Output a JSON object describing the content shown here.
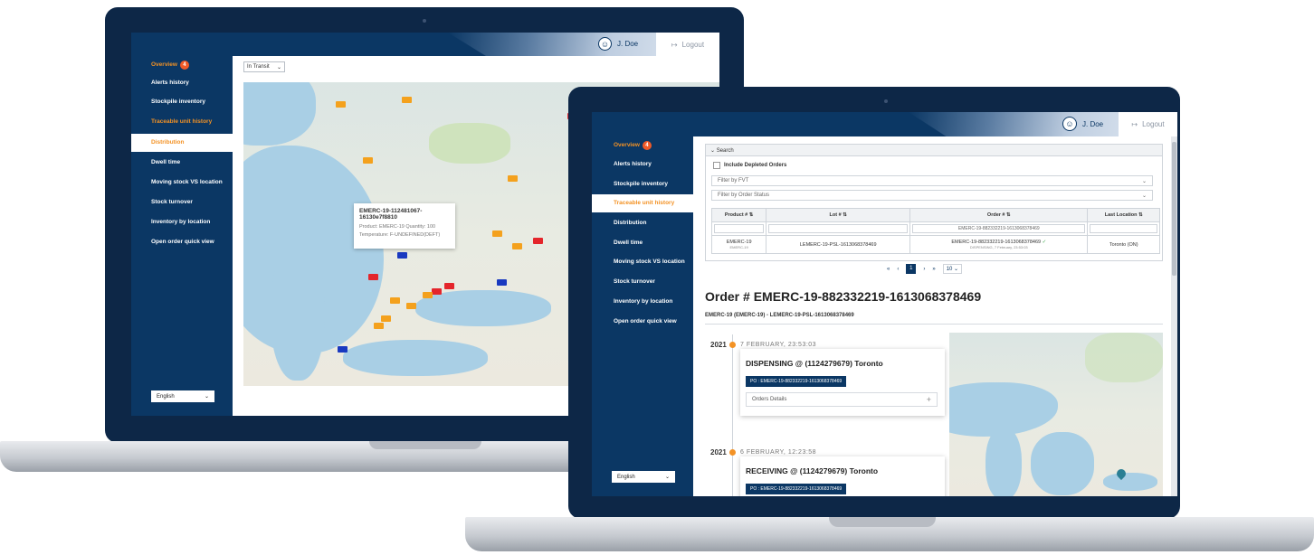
{
  "app": {
    "user_name": "J. Doe",
    "logout_label": "Logout",
    "language": "English",
    "nav": [
      {
        "label": "Overview",
        "badge": "4"
      },
      {
        "label": "Alerts history"
      },
      {
        "label": "Stockpile inventory"
      },
      {
        "label": "Traceable unit history"
      },
      {
        "label": "Distribution"
      },
      {
        "label": "Dwell time"
      },
      {
        "label": "Moving stock VS location"
      },
      {
        "label": "Stock turnover"
      },
      {
        "label": "Inventory by location"
      },
      {
        "label": "Open order quick view"
      }
    ]
  },
  "left_screen": {
    "active_nav": "Distribution",
    "status_filter": "In Transit",
    "popup": {
      "title_line1": "EMERC-19-112481067-",
      "title_line2": "16130e7f8810",
      "line2": "Product: EMERC-19    Quantity: 100",
      "line3": "Temperature: F-UNDEFINED(DEFT)"
    }
  },
  "right_screen": {
    "active_nav": "Traceable unit history",
    "search_label": "Search",
    "include_depleted": "Include Depleted Orders",
    "filter_fvt": "Filter by FVT",
    "filter_status": "Filter by Order Status",
    "table": {
      "headers": [
        "Product #",
        "Lot #",
        "Order #",
        "Last Location"
      ],
      "search_order_value": "EMERC-19-882332219-1613068378469",
      "row": {
        "product": "EMERC-19",
        "product_sub": "EMERC-19",
        "lot": "LEMERC-19-PSL-1613068378469",
        "order": "EMERC-19-882332219-1613068378469",
        "order_sub": "DISPENSING, 7 February, 23:53:03",
        "location": "Toronto (ON)"
      }
    },
    "pagination": {
      "first": "«",
      "prev": "‹",
      "current": "1",
      "next": "›",
      "last": "»",
      "page_size": "10"
    },
    "order_title": "Order # EMERC-19-882332219-1613068378469",
    "order_subtitle": "EMERC-19 (EMERC-19) - LEMERC-19-PSL-1613068378469",
    "timeline": [
      {
        "year": "2021",
        "date": "7 FEBRUARY, 23:53:03",
        "title": "DISPENSING @ (1124279679) Toronto",
        "po": "PO : EMERC-19-882332219-1613068378469",
        "details": "Orders Details"
      },
      {
        "year": "2021",
        "date": "6 FEBRUARY, 12:23:58",
        "title": "RECEIVING @ (1124279679) Toronto",
        "po": "PO : EMERC-19-882332219-1613068378469"
      }
    ]
  },
  "colors": {
    "navy": "#0b3764",
    "orange": "#f39225",
    "badge": "#f05a28"
  }
}
